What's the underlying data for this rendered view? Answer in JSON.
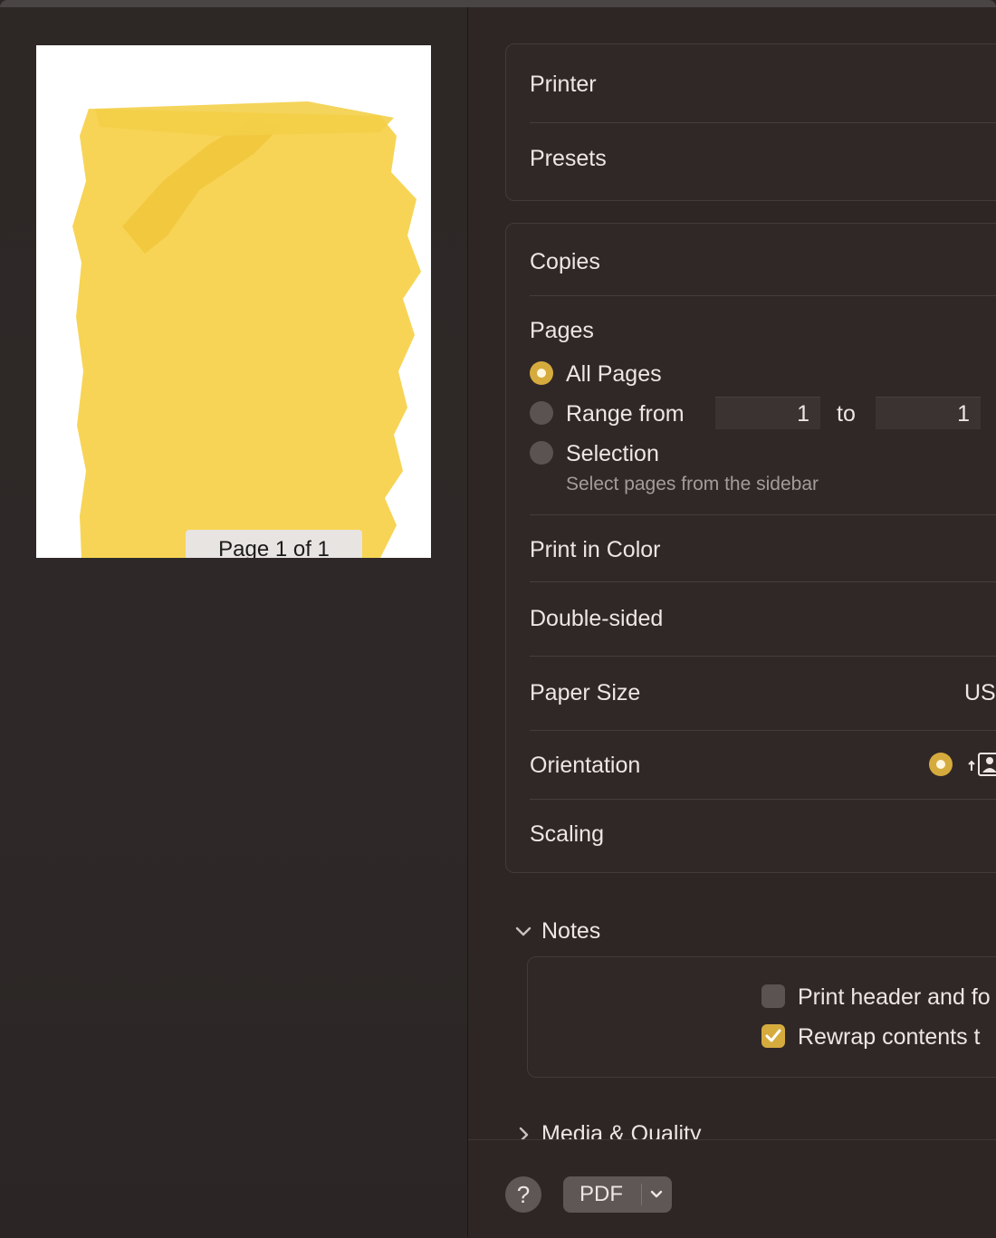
{
  "preview": {
    "page_label": "Page 1 of 1"
  },
  "group1": {
    "printer_label": "Printer",
    "presets_label": "Presets"
  },
  "group2": {
    "copies_label": "Copies",
    "pages_label": "Pages",
    "pages_options": {
      "all": "All Pages",
      "range": "Range from",
      "range_to": "to",
      "range_from_value": "1",
      "range_to_value": "1",
      "selection": "Selection",
      "selection_hint": "Select pages from the sidebar"
    },
    "print_in_color_label": "Print in Color",
    "double_sided_label": "Double-sided",
    "paper_size_label": "Paper Size",
    "paper_size_value": "US",
    "orientation_label": "Orientation",
    "scaling_label": "Scaling"
  },
  "notes": {
    "section_label": "Notes",
    "print_header_label": "Print header and fo",
    "rewrap_label": "Rewrap contents t"
  },
  "media_quality": {
    "section_label": "Media & Quality"
  },
  "bottom": {
    "help_label": "?",
    "pdf_label": "PDF"
  },
  "colors": {
    "accent": "#d6ab3e",
    "highlight": "#f7d455"
  }
}
